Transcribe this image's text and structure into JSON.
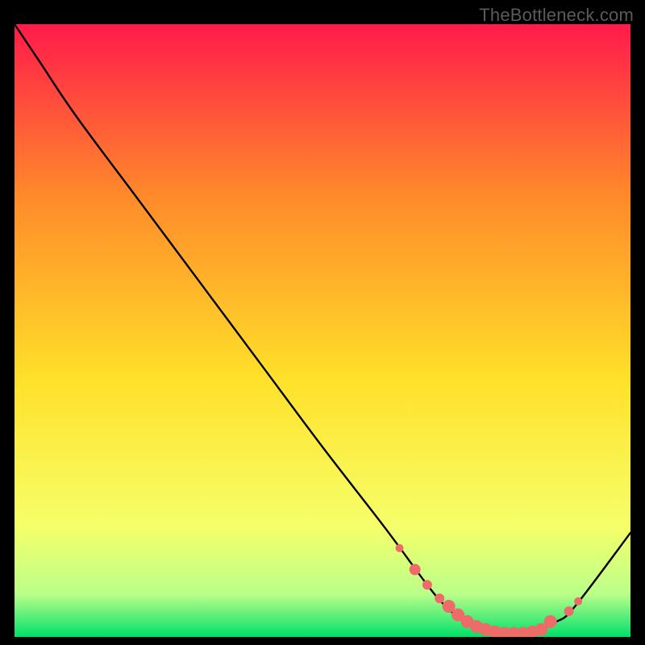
{
  "watermark": "TheBottleneck.com",
  "colors": {
    "curve": "#000000",
    "marker_fill": "#ed6b68",
    "marker_stroke": "#ed6b68",
    "gradient_top": "#ff1a4b",
    "gradient_mid1": "#ff8a2a",
    "gradient_mid2": "#ffe12a",
    "gradient_low1": "#f6ff6a",
    "gradient_low2": "#baff8a",
    "gradient_bottom": "#00e06a"
  },
  "chart_data": {
    "type": "line",
    "title": "",
    "xlabel": "",
    "ylabel": "",
    "xlim": [
      0,
      100
    ],
    "ylim": [
      0,
      100
    ],
    "x": [
      0,
      4,
      10,
      20,
      30,
      40,
      50,
      60,
      67,
      70,
      73,
      76,
      79,
      82,
      85,
      88,
      91,
      100
    ],
    "y": [
      100,
      94,
      85,
      71.5,
      58,
      44.5,
      31,
      18,
      8.5,
      5,
      2.5,
      1.2,
      0.6,
      0.6,
      1.2,
      2.5,
      5,
      17
    ],
    "markers": {
      "x": [
        62.5,
        65,
        67,
        69,
        70.5,
        72,
        73.5,
        75,
        76.5,
        78,
        79.5,
        81,
        82.5,
        84,
        85.5,
        87,
        90,
        91.5
      ],
      "y": [
        14.5,
        11,
        8.5,
        6.3,
        5,
        3.6,
        2.5,
        1.7,
        1.2,
        0.8,
        0.6,
        0.6,
        0.6,
        0.8,
        1.2,
        2.5,
        4.2,
        5.8
      ],
      "r": [
        5,
        7,
        6,
        6,
        8,
        8,
        8,
        8,
        8,
        8,
        8,
        8,
        8,
        8,
        8,
        8,
        6,
        5
      ]
    }
  }
}
